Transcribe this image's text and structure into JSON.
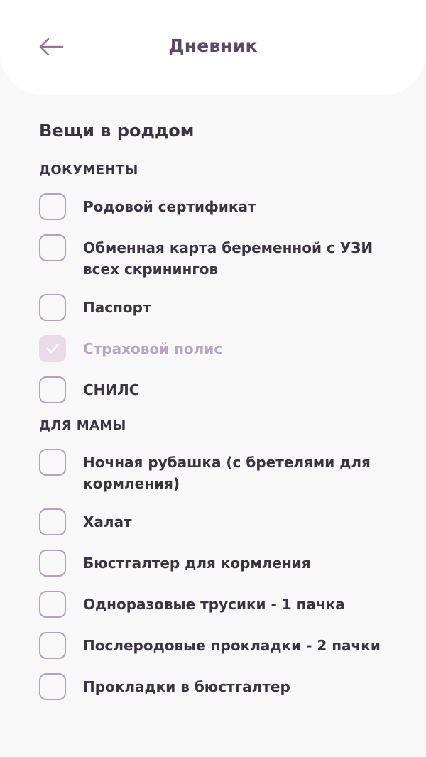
{
  "header": {
    "title": "Дневник"
  },
  "section": {
    "title": "Вещи в роддом"
  },
  "groups": [
    {
      "title": "ДОКУМЕНТЫ",
      "items": [
        {
          "label": "Родовой сертификат",
          "checked": false
        },
        {
          "label": "Обменная карта беременной с УЗИ всех скринингов",
          "checked": false
        },
        {
          "label": "Паспорт",
          "checked": false
        },
        {
          "label": "Страховой полис",
          "checked": true
        },
        {
          "label": "СНИЛС",
          "checked": false
        }
      ]
    },
    {
      "title": "ДЛЯ МАМЫ",
      "items": [
        {
          "label": "Ночная рубашка (с бретелями для кормления)",
          "checked": false
        },
        {
          "label": "Халат",
          "checked": false
        },
        {
          "label": "Бюстгалтер для кормления",
          "checked": false
        },
        {
          "label": "Одноразовые трусики - 1 пачка",
          "checked": false
        },
        {
          "label": "Послеродовые прокладки - 2 пачки",
          "checked": false
        },
        {
          "label": "Прокладки в бюстгалтер",
          "checked": false
        }
      ]
    }
  ],
  "colors": {
    "accent": "#5b4a66",
    "checkbox_border": "#b3a2bb",
    "checked_bg": "#eadbe8",
    "checked_text": "#b7a6bf"
  },
  "icons": {
    "back": "arrow-left-icon",
    "check": "check-icon"
  }
}
